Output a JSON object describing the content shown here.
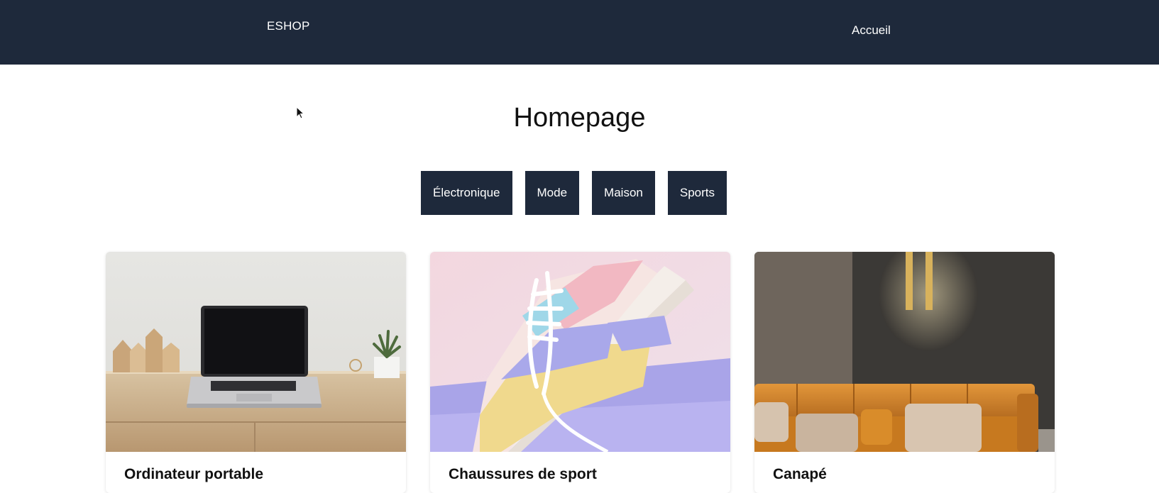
{
  "navbar": {
    "brand": "ESHOP",
    "home_link": "Accueil"
  },
  "main": {
    "title": "Homepage"
  },
  "categories": [
    {
      "label": "Électronique"
    },
    {
      "label": "Mode"
    },
    {
      "label": "Maison"
    },
    {
      "label": "Sports"
    }
  ],
  "products": [
    {
      "title": "Ordinateur portable",
      "image": "laptop-on-desk"
    },
    {
      "title": "Chaussures de sport",
      "image": "pastel-sneaker"
    },
    {
      "title": "Canapé",
      "image": "orange-leather-sofa"
    }
  ],
  "colors": {
    "navbar": "#1e293b",
    "button": "#1e293b",
    "text": "#111111"
  }
}
